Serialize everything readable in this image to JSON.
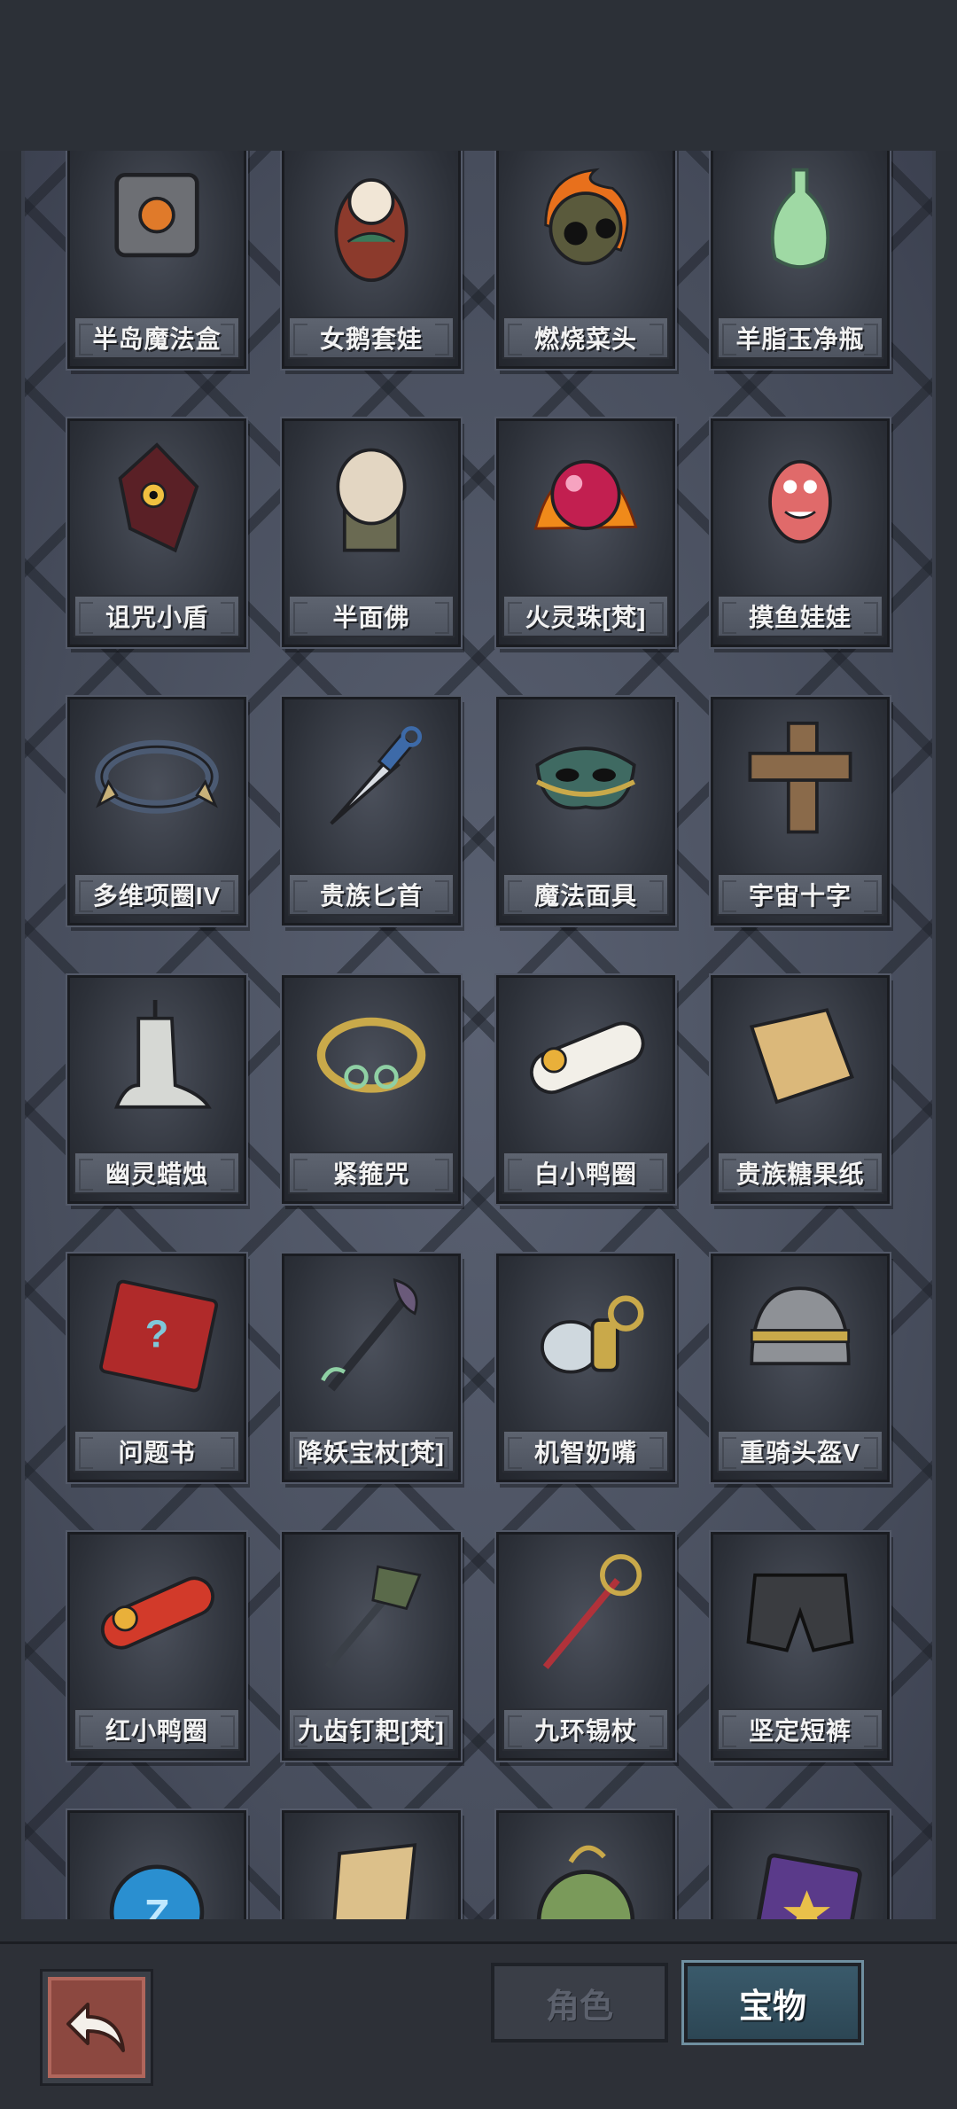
{
  "tabs": {
    "role_label": "角色",
    "treasure_label": "宝物"
  },
  "items": [
    {
      "name": "半岛魔法盒",
      "icon": "magic-box-icon"
    },
    {
      "name": "女鹅套娃",
      "icon": "nesting-doll-icon"
    },
    {
      "name": "燃烧菜头",
      "icon": "burning-head-icon"
    },
    {
      "name": "羊脂玉净瓶",
      "icon": "jade-vase-icon"
    },
    {
      "name": "诅咒小盾",
      "icon": "cursed-shield-icon"
    },
    {
      "name": "半面佛",
      "icon": "half-buddha-icon"
    },
    {
      "name": "火灵珠[梵]",
      "icon": "fire-orb-icon"
    },
    {
      "name": "摸鱼娃娃",
      "icon": "fish-doll-icon"
    },
    {
      "name": "多维项圈IV",
      "icon": "collar-icon"
    },
    {
      "name": "贵族匕首",
      "icon": "dagger-icon"
    },
    {
      "name": "魔法面具",
      "icon": "mask-icon"
    },
    {
      "name": "宇宙十字",
      "icon": "cross-icon"
    },
    {
      "name": "幽灵蜡烛",
      "icon": "ghost-candle-icon"
    },
    {
      "name": "紧箍咒",
      "icon": "golden-hoop-icon"
    },
    {
      "name": "白小鸭圈",
      "icon": "white-duck-ring-icon"
    },
    {
      "name": "贵族糖果纸",
      "icon": "candy-paper-icon"
    },
    {
      "name": "问题书",
      "icon": "question-book-icon"
    },
    {
      "name": "降妖宝杖[梵]",
      "icon": "demon-staff-icon"
    },
    {
      "name": "机智奶嘴",
      "icon": "pacifier-icon"
    },
    {
      "name": "重骑头盔V",
      "icon": "helmet-icon"
    },
    {
      "name": "红小鸭圈",
      "icon": "red-duck-ring-icon"
    },
    {
      "name": "九齿钉耙[梵]",
      "icon": "rake-icon"
    },
    {
      "name": "九环锡杖",
      "icon": "tin-staff-icon"
    },
    {
      "name": "坚定短裤",
      "icon": "shorts-icon"
    },
    {
      "name": "",
      "icon": "blue-rune-orb-icon"
    },
    {
      "name": "",
      "icon": "scroll-icon"
    },
    {
      "name": "",
      "icon": "green-egg-icon"
    },
    {
      "name": "",
      "icon": "purple-book-icon"
    }
  ]
}
